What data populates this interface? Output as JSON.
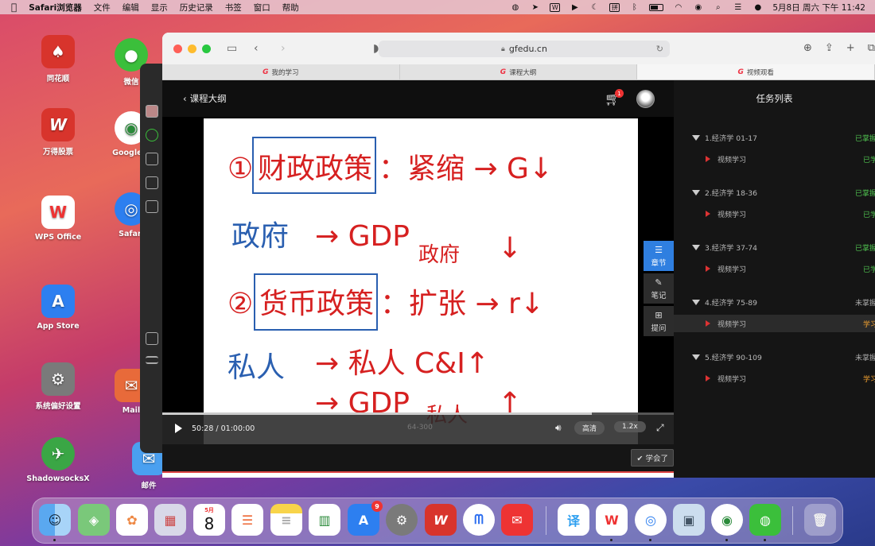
{
  "menubar": {
    "apple": "",
    "app_name": "Safari浏览器",
    "menus": [
      "文件",
      "编辑",
      "显示",
      "历史记录",
      "书签",
      "窗口",
      "帮助"
    ],
    "datetime": "5月8日 周六 下午 11:42"
  },
  "desktop": {
    "icons": [
      {
        "label": "同花顺",
        "glyph": "♠",
        "color": "#d8342c"
      },
      {
        "label": "万得股票",
        "glyph": "W",
        "color": "#d8342c"
      },
      {
        "label": "WPS Office",
        "glyph": "W",
        "color": "#ffffff"
      },
      {
        "label": "App Store",
        "glyph": "A",
        "color": "#2d7ff0"
      },
      {
        "label": "系统偏好设置",
        "glyph": "⚙",
        "color": "#7a7a7a"
      },
      {
        "label": "ShadowsocksX",
        "glyph": "✈",
        "color": "#3aa645"
      },
      {
        "label": "微信",
        "glyph": "●",
        "color": "#3bbf3b"
      },
      {
        "label": "Google C",
        "glyph": "◉",
        "color": "#ffffff"
      },
      {
        "label": "Safari",
        "glyph": "◎",
        "color": "#2d7ff0"
      },
      {
        "label": "Mail",
        "glyph": "✉",
        "color": "#ffffff"
      },
      {
        "label": "邮件",
        "glyph": "✉",
        "color": "#4aa0f0"
      }
    ]
  },
  "browser": {
    "url": "gfedu.cn",
    "tabs": [
      {
        "label": "我的学习",
        "active": false
      },
      {
        "label": "课程大纲",
        "active": false
      },
      {
        "label": "视频观看",
        "active": true
      }
    ]
  },
  "page": {
    "back_label": "课程大纲",
    "cart_count": "1",
    "task_list_title": "任务列表",
    "player": {
      "time": "50:28 / 01:00:00",
      "progress": 0.84,
      "page_no": "64-300",
      "quality": "高清",
      "speed": "1.2x"
    },
    "learned_label": "学会了",
    "side_buttons": [
      {
        "label": "章节",
        "icon": "list-icon",
        "active": true
      },
      {
        "label": "笔记",
        "icon": "pencil-icon",
        "active": false
      },
      {
        "label": "提问",
        "icon": "question-icon",
        "active": false
      }
    ],
    "chapters": [
      {
        "title": "1.经济学 01-17",
        "status": "已掌握",
        "item": "视频学习",
        "item_status": "已学"
      },
      {
        "title": "2.经济学 18-36",
        "status": "已掌握",
        "item": "视频学习",
        "item_status": "已学"
      },
      {
        "title": "3.经济学 37-74",
        "status": "已掌握",
        "item": "视频学习",
        "item_status": "已学"
      },
      {
        "title": "4.经济学 75-89",
        "status": "未掌握",
        "item": "视频学习",
        "item_status": "学习中"
      },
      {
        "title": "5.经济学 90-109",
        "status": "未掌握",
        "item": "视频学习",
        "item_status": "学习中"
      }
    ]
  },
  "slide": {
    "line1_num": "①",
    "line1_boxed": "财政政策",
    "line1_rest": "：紧缩 → G↓",
    "line2_left": "政府",
    "line2_mid": "→ GDP",
    "line2_sub": "政府",
    "line2_arrow": "↓",
    "line3_num": "②",
    "line3_boxed": "货币政策",
    "line3_rest": "：扩张 → r↓",
    "line4_left": "私人",
    "line4_mid": "→ 私人 C&I↑",
    "line5_mid": "→ GDP",
    "line5_sub": "私人",
    "line5_arrow": "↑",
    "blue": "#2a5fb0",
    "red": "#d62020"
  },
  "dock": {
    "calendar_month": "5月",
    "calendar_day": "8",
    "appstore_badge": "9"
  }
}
